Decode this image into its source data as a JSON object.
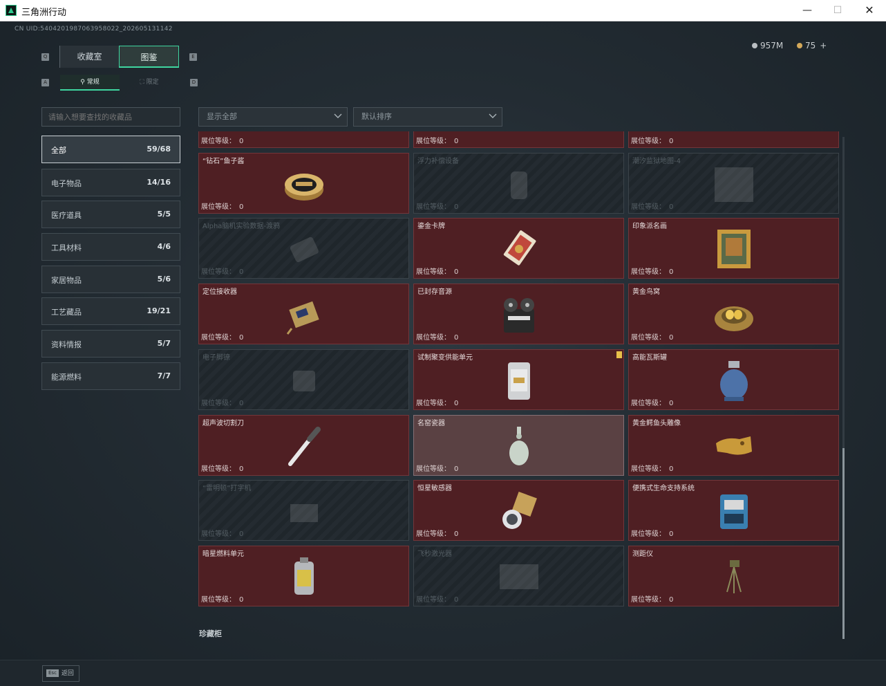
{
  "window": {
    "title": "三角洲行动"
  },
  "header": {
    "uid": "CN UID:5404201987063958022_202605131142",
    "currency": [
      {
        "icon": "silver-coin-icon",
        "value": "957M"
      },
      {
        "icon": "gold-coin-icon",
        "value": "75"
      }
    ],
    "plus_label": "+"
  },
  "tabs": {
    "key_left": "Q",
    "key_right": "E",
    "collection": "收藏室",
    "atlas": "图鉴"
  },
  "subtabs": {
    "key_left": "A",
    "key_right": "D",
    "normal": "常规",
    "limited": "限定"
  },
  "search": {
    "placeholder": "请输入想要查找的收藏品"
  },
  "filters": {
    "display": "显示全部",
    "sort": "默认排序"
  },
  "categories": [
    {
      "label": "全部",
      "count": "59/68"
    },
    {
      "label": "电子物品",
      "count": "14/16"
    },
    {
      "label": "医疗道具",
      "count": "5/5"
    },
    {
      "label": "工具材料",
      "count": "4/6"
    },
    {
      "label": "家居物品",
      "count": "5/6"
    },
    {
      "label": "工艺藏品",
      "count": "19/21"
    },
    {
      "label": "资料情报",
      "count": "5/7"
    },
    {
      "label": "能源燃料",
      "count": "7/7"
    }
  ],
  "level_label": "展位等级：",
  "items": [
    {
      "name": "",
      "level": "0",
      "owned": true,
      "icon": "gold-artifact-icon"
    },
    {
      "name": "",
      "level": "0",
      "owned": true,
      "icon": "gold-artifact-icon"
    },
    {
      "name": "",
      "level": "0",
      "owned": true,
      "icon": "blue-artifact-icon"
    },
    {
      "name": "“钻石”鱼子酱",
      "level": "0",
      "owned": true,
      "icon": "caviar-tin-icon"
    },
    {
      "name": "浮力补偿设备",
      "level": "0",
      "owned": false,
      "icon": "buoyancy-device-icon"
    },
    {
      "name": "潮汐监狱地图-4",
      "level": "0",
      "owned": false,
      "icon": "map-icon"
    },
    {
      "name": "Alpha脑机实验数据-渡鸦",
      "level": "0",
      "owned": false,
      "icon": "data-device-icon"
    },
    {
      "name": "鎏金卡牌",
      "level": "0",
      "owned": true,
      "icon": "gilded-card-icon"
    },
    {
      "name": "印象派名画",
      "level": "0",
      "owned": true,
      "icon": "framed-painting-icon"
    },
    {
      "name": "定位接收器",
      "level": "0",
      "owned": true,
      "icon": "receiver-icon"
    },
    {
      "name": "已封存音源",
      "level": "0",
      "owned": true,
      "icon": "reel-recorder-icon"
    },
    {
      "name": "黄金鸟窝",
      "level": "0",
      "owned": true,
      "icon": "golden-nest-icon"
    },
    {
      "name": "电子脚镣",
      "level": "0",
      "owned": false,
      "icon": "ankle-monitor-icon"
    },
    {
      "name": "试制聚变供能单元",
      "level": "0",
      "owned": true,
      "icon": "fusion-cell-icon",
      "badge": true
    },
    {
      "name": "高能瓦斯罐",
      "level": "0",
      "owned": true,
      "icon": "gas-tank-icon"
    },
    {
      "name": "超声波切割刀",
      "level": "0",
      "owned": true,
      "icon": "ultrasonic-knife-icon"
    },
    {
      "name": "名窑瓷器",
      "level": "0",
      "owned": true,
      "icon": "porcelain-vase-icon",
      "highlight": true
    },
    {
      "name": "黄金鳄鱼头雕像",
      "level": "0",
      "owned": true,
      "icon": "gold-crocodile-icon"
    },
    {
      "name": "“雷明顿”打字机",
      "level": "0",
      "owned": false,
      "icon": "typewriter-icon"
    },
    {
      "name": "恒星敏感器",
      "level": "0",
      "owned": true,
      "icon": "star-sensor-icon"
    },
    {
      "name": "便携式生命支持系统",
      "level": "0",
      "owned": true,
      "icon": "life-support-icon"
    },
    {
      "name": "暗星燃料单元",
      "level": "0",
      "owned": true,
      "icon": "fuel-canister-icon"
    },
    {
      "name": "飞秒激光器",
      "level": "0",
      "owned": false,
      "icon": "laser-device-icon"
    },
    {
      "name": "测距仪",
      "level": "0",
      "owned": true,
      "icon": "rangefinder-tripod-icon"
    }
  ],
  "section_title": "珍藏柜",
  "footer": {
    "esc_key": "Esc",
    "back_label": "返回"
  }
}
